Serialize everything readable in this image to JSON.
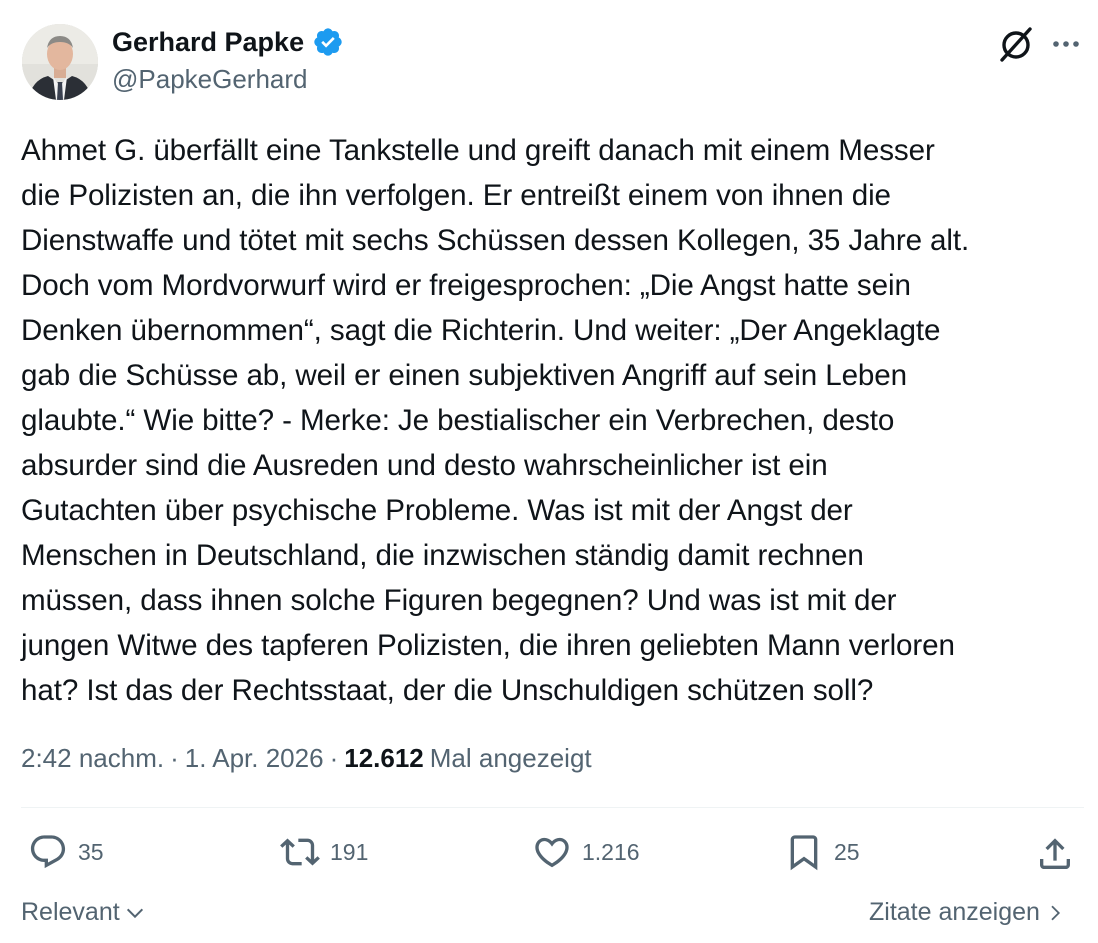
{
  "author": {
    "display_name": "Gerhard Papke",
    "handle": "@PapkeGerhard"
  },
  "icons": {
    "avatar": "profile-photo",
    "verified": "verified-badge-icon",
    "grok": "grok-icon",
    "more": "more-icon",
    "reply": "reply-icon",
    "retweet": "retweet-icon",
    "like": "like-icon",
    "bookmark": "bookmark-icon",
    "share": "share-icon"
  },
  "tweet": {
    "text": "Ahmet G. überfällt eine Tankstelle und greift danach mit einem Messer\ndie Polizisten an, die ihn verfolgen. Er entreißt einem von ihnen die\nDienstwaffe und tötet mit sechs Schüssen dessen Kollegen, 35 Jahre alt.\nDoch vom Mordvorwurf wird er freigesprochen: „Die Angst hatte sein\nDenken übernommen“, sagt die Richterin. Und weiter: „Der Angeklagte\ngab die Schüsse ab, weil er einen subjektiven Angriff auf sein Leben\nglaubte.“ Wie bitte? - Merke: Je bestialischer ein Verbrechen, desto\nabsurder sind die Ausreden und desto wahrscheinlicher ist ein\nGutachten über psychische Probleme. Was ist mit der Angst der\nMenschen in Deutschland, die inzwischen ständig damit rechnen\nmüssen, dass ihnen solche Figuren begegnen? Und was ist mit der\njungen Witwe des tapferen Polizisten, die ihren geliebten Mann verloren\nhat? Ist das der Rechtsstaat, der die Unschuldigen schützen soll?",
    "time": "2:42 nachm.",
    "sep1": "·",
    "date": "1. Apr. 2026",
    "sep2": "·",
    "views": "12.612",
    "views_label": "Mal angezeigt"
  },
  "actions": {
    "replies": "35",
    "retweets": "191",
    "likes": "1.216",
    "bookmarks": "25"
  },
  "footer": {
    "sort_label": "Relevant",
    "quotes_label": "Zitate anzeigen"
  },
  "colors": {
    "text": "#0f1419",
    "secondary": "#536471",
    "verified": "#1d9bf0",
    "divider": "#eff3f4"
  }
}
